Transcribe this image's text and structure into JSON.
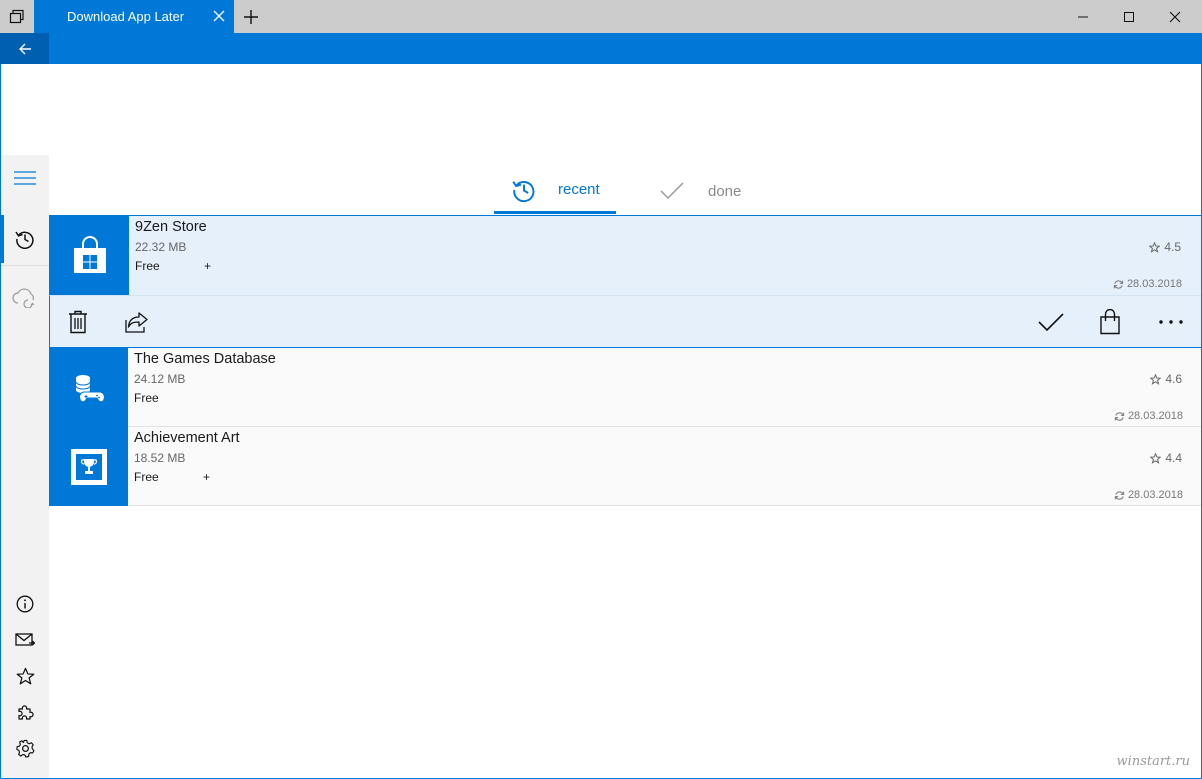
{
  "window": {
    "tab_title": "Download App Later",
    "tabs_icon": "tabs-icon",
    "new_tab_icon": "plus-icon",
    "controls": [
      "minimize-icon",
      "maximize-icon",
      "close-icon"
    ]
  },
  "appbar": {
    "back_icon": "back-arrow-icon"
  },
  "nav": {
    "top": [
      "hamburger-icon",
      "history-icon",
      "cloud-sync-icon"
    ],
    "bottom": [
      "info-icon",
      "mail-icon",
      "star-icon",
      "puzzle-icon",
      "gear-icon"
    ]
  },
  "pivot": {
    "recent_label": "recent",
    "done_label": "done"
  },
  "apps": [
    {
      "name": "9Zen Store",
      "size": "22.32 MB",
      "price": "Free",
      "extra": "+",
      "rating": "4.5",
      "date": "28.03.2018",
      "icon": "store-bag-icon",
      "selected": true
    },
    {
      "name": "The Games Database",
      "size": "24.12 MB",
      "price": "Free",
      "extra": "",
      "rating": "4.6",
      "date": "28.03.2018",
      "icon": "gamepad-database-icon",
      "selected": false
    },
    {
      "name": "Achievement Art",
      "size": "18.52 MB",
      "price": "Free",
      "extra": "+",
      "rating": "4.4",
      "date": "28.03.2018",
      "icon": "trophy-frame-icon",
      "selected": false
    }
  ],
  "actions": [
    "delete-icon",
    "share-icon",
    "checkmark-icon",
    "store-bag-icon",
    "more-icon"
  ],
  "watermark": "winstart.ru",
  "colors": {
    "accent": "#0078d7",
    "selected_bg": "#e5f0fb",
    "titlebar": "#cccccc"
  }
}
